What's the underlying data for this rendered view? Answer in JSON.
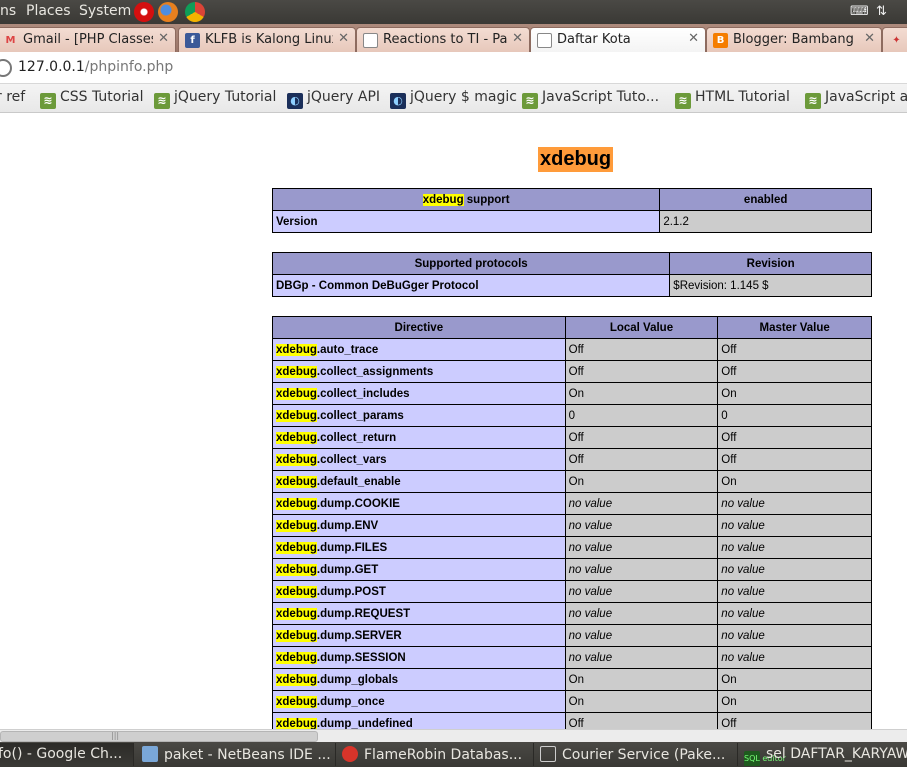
{
  "top_panel": {
    "menus": [
      "ns",
      "Places",
      "System"
    ]
  },
  "tabs": [
    {
      "title": "Gmail - [PHP Classes] Ac",
      "icon": "gmail-icon",
      "active": false
    },
    {
      "title": "KLFB is Kalong Linux Fa",
      "icon": "facebook-icon",
      "active": false
    },
    {
      "title": "Reactions to TI - Page",
      "icon": "page-icon",
      "active": false
    },
    {
      "title": "Daftar Kota",
      "icon": "page-icon",
      "active": true
    },
    {
      "title": "Blogger: Bambang P nc",
      "icon": "blogger-icon",
      "active": false
    }
  ],
  "address": {
    "host": "127.0.0.1",
    "path": "/phpinfo.php"
  },
  "bookmarks": [
    {
      "label": "r ref",
      "icon": ""
    },
    {
      "label": "CSS Tutorial",
      "icon": "w3"
    },
    {
      "label": "jQuery Tutorial",
      "icon": "w3"
    },
    {
      "label": "jQuery API",
      "icon": "jq"
    },
    {
      "label": "jQuery $ magic",
      "icon": "jq"
    },
    {
      "label": "JavaScript Tuto...",
      "icon": "w3"
    },
    {
      "label": "HTML Tutorial",
      "icon": "w3"
    },
    {
      "label": "JavaScript a",
      "icon": "w3"
    }
  ],
  "page": {
    "module_title": "xdebug",
    "support_table": {
      "header": {
        "highlight": "xdebug",
        "rest": " support",
        "value": "enabled"
      },
      "rows": [
        {
          "label": "Version",
          "value": "2.1.2"
        }
      ]
    },
    "protocols_table": {
      "headers": [
        "Supported protocols",
        "Revision"
      ],
      "rows": [
        {
          "label": "DBGp - Common DeBuGger Protocol",
          "value": "$Revision: 1.145 $"
        }
      ]
    },
    "directives_table": {
      "headers": [
        "Directive",
        "Local Value",
        "Master Value"
      ],
      "prefix": "xdebug",
      "rows": [
        {
          "name": ".auto_trace",
          "local": "Off",
          "master": "Off"
        },
        {
          "name": ".collect_assignments",
          "local": "Off",
          "master": "Off"
        },
        {
          "name": ".collect_includes",
          "local": "On",
          "master": "On"
        },
        {
          "name": ".collect_params",
          "local": "0",
          "master": "0"
        },
        {
          "name": ".collect_return",
          "local": "Off",
          "master": "Off"
        },
        {
          "name": ".collect_vars",
          "local": "Off",
          "master": "Off"
        },
        {
          "name": ".default_enable",
          "local": "On",
          "master": "On"
        },
        {
          "name": ".dump.COOKIE",
          "local": "no value",
          "master": "no value"
        },
        {
          "name": ".dump.ENV",
          "local": "no value",
          "master": "no value"
        },
        {
          "name": ".dump.FILES",
          "local": "no value",
          "master": "no value"
        },
        {
          "name": ".dump.GET",
          "local": "no value",
          "master": "no value"
        },
        {
          "name": ".dump.POST",
          "local": "no value",
          "master": "no value"
        },
        {
          "name": ".dump.REQUEST",
          "local": "no value",
          "master": "no value"
        },
        {
          "name": ".dump.SERVER",
          "local": "no value",
          "master": "no value"
        },
        {
          "name": ".dump.SESSION",
          "local": "no value",
          "master": "no value"
        },
        {
          "name": ".dump_globals",
          "local": "On",
          "master": "On"
        },
        {
          "name": ".dump_once",
          "local": "On",
          "master": "On"
        },
        {
          "name": ".dump_undefined",
          "local": "Off",
          "master": "Off"
        }
      ]
    }
  },
  "taskbar": [
    {
      "label": "fo() - Google Ch...",
      "icon": "chrome-icon",
      "active": true
    },
    {
      "label": "paket - NetBeans IDE ...",
      "icon": "netbeans-icon",
      "active": false
    },
    {
      "label": "FlameRobin Databas...",
      "icon": "flamerobin-icon",
      "active": false
    },
    {
      "label": "Courier Service (Pake...",
      "icon": "window-icon",
      "active": false
    },
    {
      "label": "sel DAFTAR_KARYAW",
      "icon": "sql-editor-icon",
      "icon_text": "SQL editor",
      "active": false
    }
  ],
  "colors": {
    "header_bg": "#9999cc",
    "label_bg": "#ccccff",
    "value_bg": "#cccccc",
    "highlight": "#ffff00",
    "title_bg": "#ff9b3a"
  }
}
